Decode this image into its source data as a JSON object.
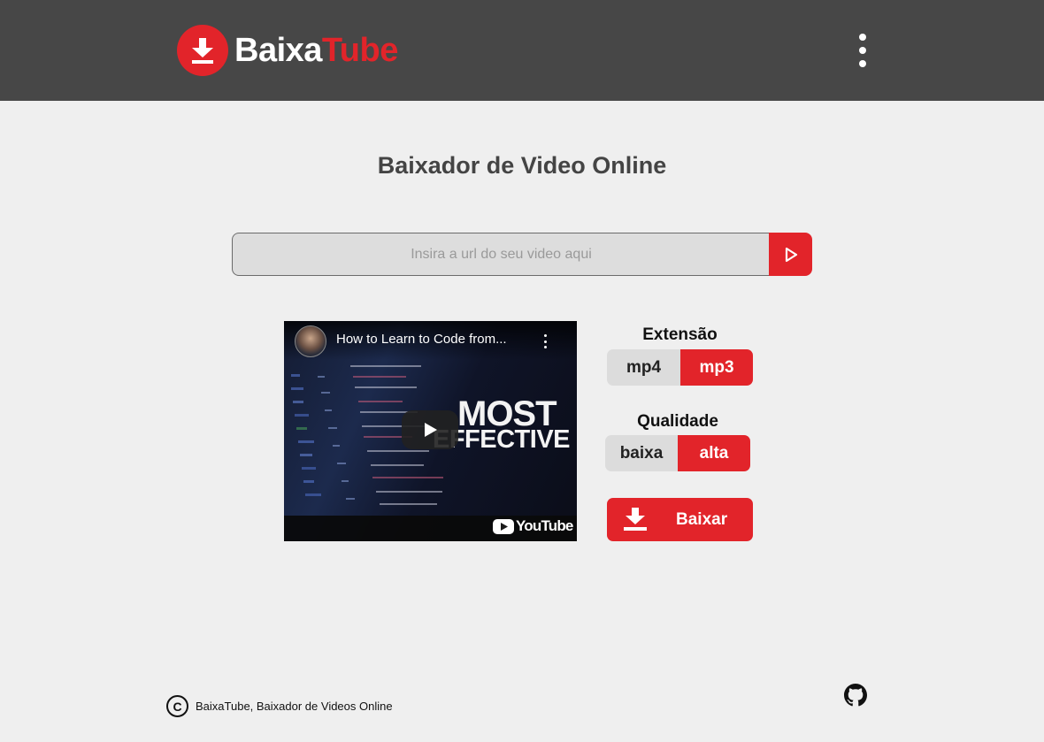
{
  "header": {
    "brand_part1": "Baixa",
    "brand_part2": "Tube",
    "logo_icon": "download-arrow-icon",
    "menu_icon": "kebab-menu-icon"
  },
  "main": {
    "title": "Baixador de Video Online",
    "url_input": {
      "placeholder": "Insira a url do seu video aqui",
      "value": ""
    },
    "submit_icon": "play-triangle-icon"
  },
  "video": {
    "title": "How to Learn to Code from...",
    "overlay_line1": "MOST",
    "overlay_line2": "EFFECTIVE",
    "platform": "YouTube"
  },
  "options": {
    "extension_label": "Extensão",
    "extension_options": [
      "mp4",
      "mp3"
    ],
    "extension_selected": "mp3",
    "quality_label": "Qualidade",
    "quality_options": [
      "baixa",
      "alta"
    ],
    "quality_selected": "alta",
    "download_label": "Baixar"
  },
  "footer": {
    "copyright_text": "BaixaTube, Baixador de Videos Online",
    "copyright_icon": "copyright-icon",
    "github_icon": "github-icon"
  },
  "colors": {
    "header_bg": "#474747",
    "page_bg": "#efefef",
    "accent": "#e2242a",
    "unselected_bg": "#dcdcdc"
  }
}
